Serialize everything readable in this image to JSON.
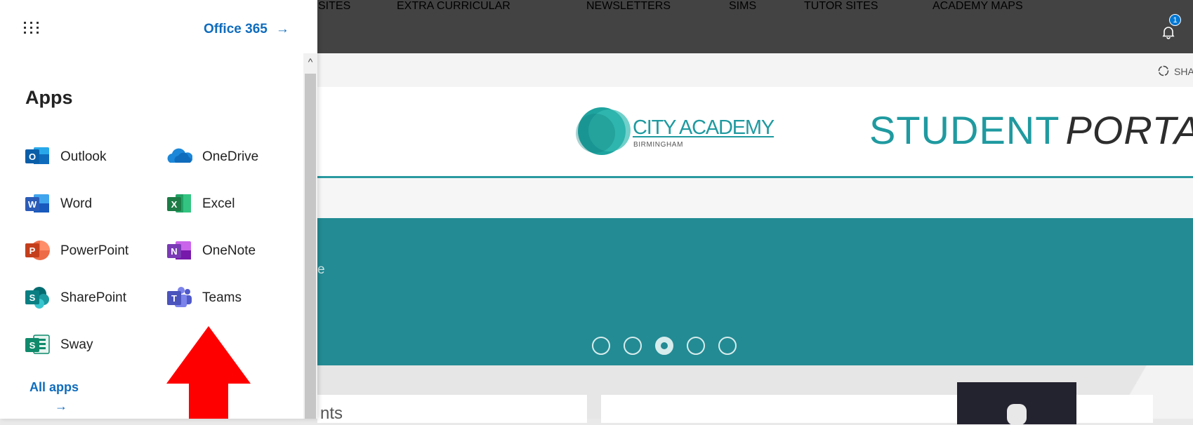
{
  "launcher": {
    "office365_label": "Office 365",
    "office365_arrow": "→",
    "apps_heading": "Apps",
    "apps": [
      {
        "label": "Outlook",
        "icon": "outlook-icon",
        "color": "#0f6cbd"
      },
      {
        "label": "OneDrive",
        "icon": "onedrive-icon",
        "color": "#1c87d8"
      },
      {
        "label": "Word",
        "icon": "word-icon",
        "color": "#2b5cb8"
      },
      {
        "label": "Excel",
        "icon": "excel-icon",
        "color": "#1d7b45"
      },
      {
        "label": "PowerPoint",
        "icon": "powerpoint-icon",
        "color": "#d24726"
      },
      {
        "label": "OneNote",
        "icon": "onenote-icon",
        "color": "#7a3ab5"
      },
      {
        "label": "SharePoint",
        "icon": "sharepoint-icon",
        "color": "#0a7f83"
      },
      {
        "label": "Teams",
        "icon": "teams-icon",
        "color": "#5059c9"
      },
      {
        "label": "Sway",
        "icon": "sway-icon",
        "color": "#0f8a6b"
      }
    ],
    "all_apps_label": "All apps",
    "all_apps_arrow": "→"
  },
  "topbar": {
    "notification_count": "1"
  },
  "command_bar": {
    "share_label": "SHA"
  },
  "header": {
    "logo_title": "CITY ACADEMY",
    "logo_subtitle": "BIRMINGHAM",
    "portal_word1": "STUDENT",
    "portal_word2": "PORTAL"
  },
  "nav": {
    "items": [
      "SITES",
      "EXTRA CURRICULAR",
      "NEWSLETTERS",
      "SIMS",
      "TUTOR SITES",
      "ACADEMY MAPS"
    ]
  },
  "hero": {
    "text_fragment": "e",
    "carousel_active_index": 2,
    "carousel_count": 5
  },
  "content": {
    "card_text_fragment": "nts"
  },
  "colors": {
    "accent": "#238b94",
    "link": "#0f6cbd",
    "annotation_arrow": "#ff0000"
  }
}
